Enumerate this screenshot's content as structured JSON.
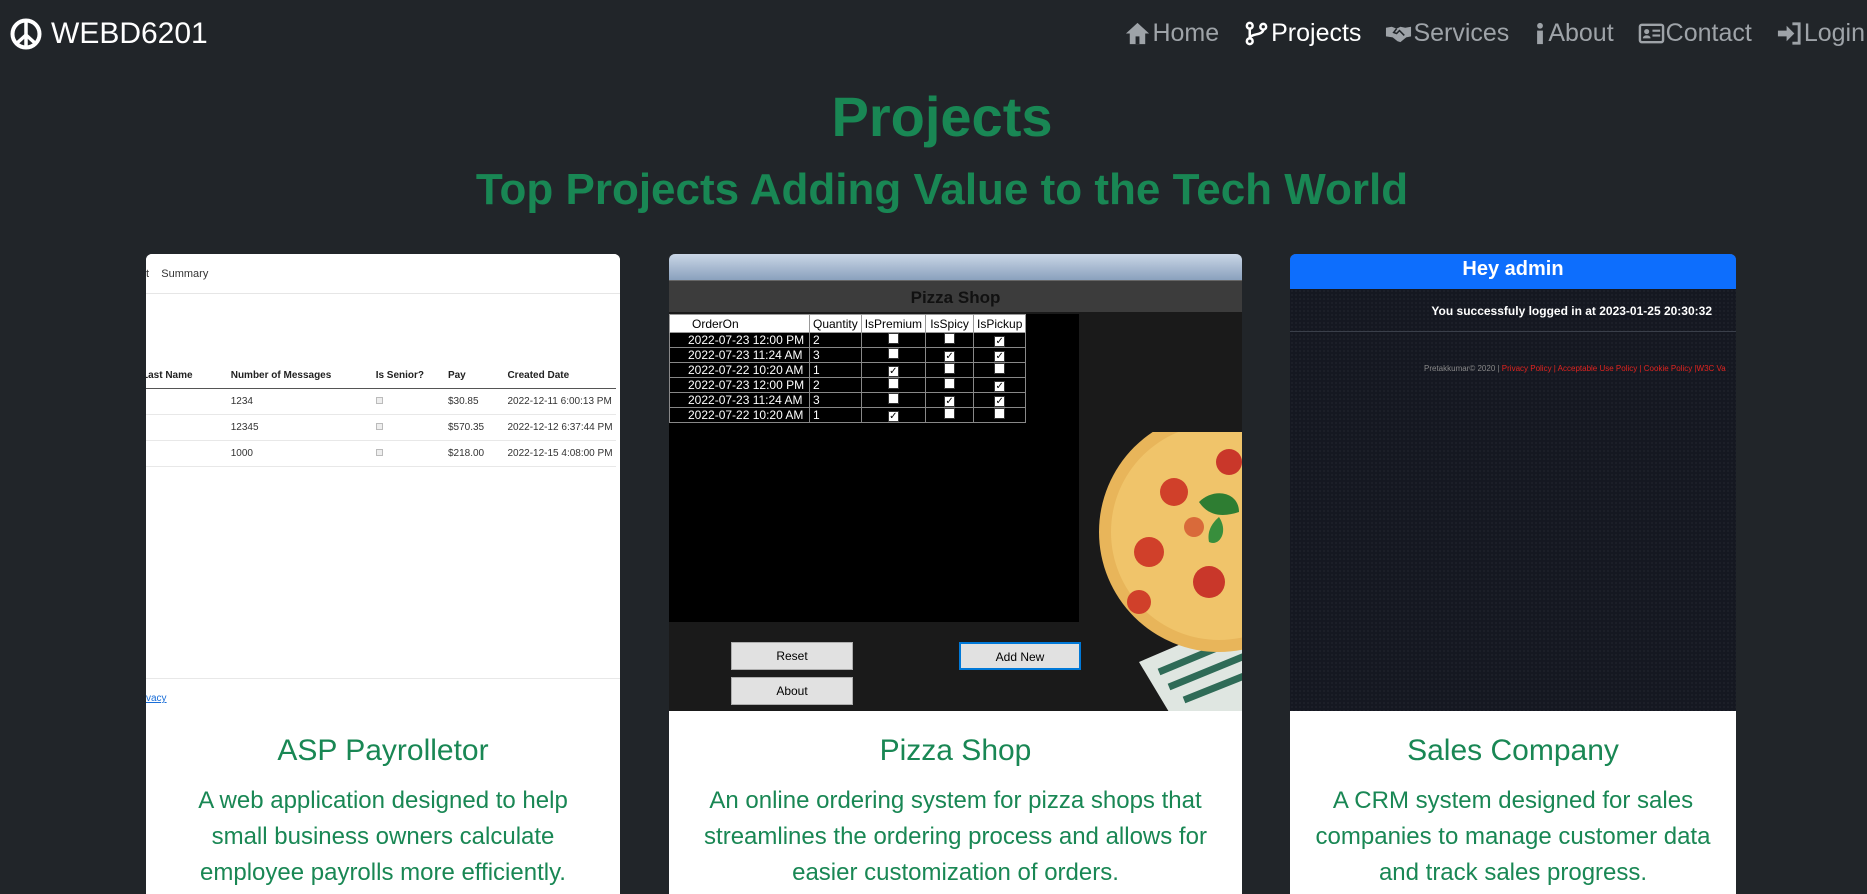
{
  "brand": {
    "name": "WEBD6201",
    "icon": "peace-icon"
  },
  "nav": [
    {
      "label": "Home",
      "icon": "home-icon",
      "active": false
    },
    {
      "label": "Projects",
      "icon": "branch-icon",
      "active": true
    },
    {
      "label": "Services",
      "icon": "handshake-icon",
      "active": false
    },
    {
      "label": "About",
      "icon": "info-icon",
      "active": false
    },
    {
      "label": "Contact",
      "icon": "contact-card-icon",
      "active": false
    },
    {
      "label": "Login",
      "icon": "login-icon",
      "active": false
    }
  ],
  "heading": "Projects",
  "subheading": "Top Projects Adding Value to the Tech World",
  "colors": {
    "accent": "#198754",
    "background": "#212529",
    "nav_muted": "#9ea3a8"
  },
  "cards": [
    {
      "title": "ASP Payrolletor",
      "description": "A web application designed to help small business owners calculate employee payrolls more efficiently.",
      "screenshot": {
        "tab": "t    Summary",
        "columns": [
          "Last Name",
          "Number of Messages",
          "Is Senior?",
          "Pay",
          "Created Date"
        ],
        "rows": [
          [
            "",
            "1234",
            "",
            "$30.85",
            "2022-12-11 6:00:13 PM"
          ],
          [
            "",
            "12345",
            "",
            "$570.35",
            "2022-12-12 6:37:44 PM"
          ],
          [
            "",
            "1000",
            "",
            "$218.00",
            "2022-12-15 4:08:00 PM"
          ]
        ],
        "footer_link": "vacy"
      }
    },
    {
      "title": "Pizza Shop",
      "description": "An online ordering system for pizza shops that streamlines the ordering process and allows for easier customization of orders.",
      "screenshot": {
        "window_title": "Pizza Shop",
        "columns": [
          "OrderOn",
          "Quantity",
          "IsPremium",
          "IsSpicy",
          "IsPickup"
        ],
        "rows": [
          [
            "2022-07-23 12:00 PM",
            "2",
            "",
            "",
            "✓"
          ],
          [
            "2022-07-23 11:24 AM",
            "3",
            "",
            "✓",
            "✓"
          ],
          [
            "2022-07-22 10:20 AM",
            "1",
            "✓",
            "",
            ""
          ],
          [
            "2022-07-23 12:00 PM",
            "2",
            "",
            "",
            "✓"
          ],
          [
            "2022-07-23 11:24 AM",
            "3",
            "",
            "✓",
            "✓"
          ],
          [
            "2022-07-22 10:20 AM",
            "1",
            "✓",
            "",
            ""
          ]
        ],
        "buttons": {
          "reset": "Reset",
          "add_new": "Add New",
          "about": "About"
        }
      }
    },
    {
      "title": "Sales Company",
      "description": "A CRM system designed for sales companies to manage customer data and track sales progress.",
      "screenshot": {
        "header": "Hey admin",
        "message": "You successfuly logged in at 2023-01-25 20:30:32",
        "copyright": "Pretakkumar© 2020 |",
        "links": " Privacy Policy | Acceptable Use Policy | Cookie Policy |W3C Va"
      }
    }
  ]
}
